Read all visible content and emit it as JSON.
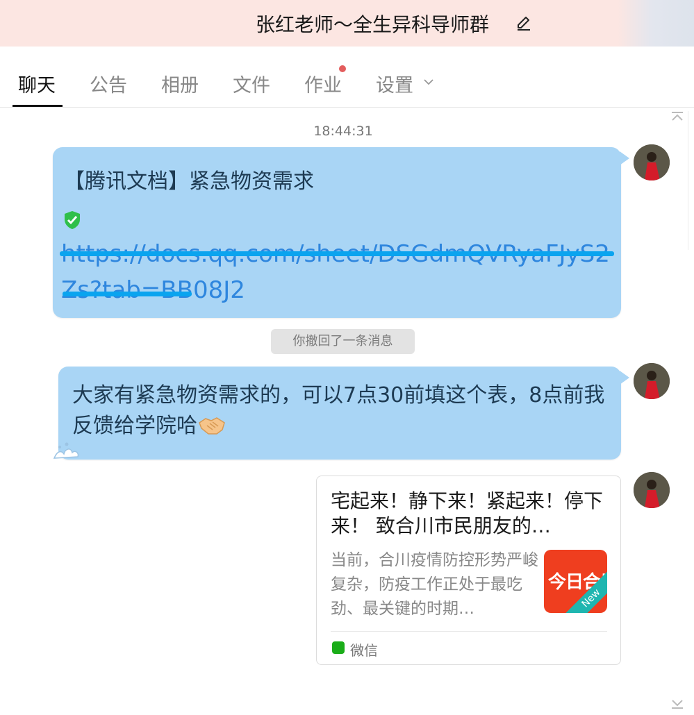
{
  "window": {
    "title": "张红老师～全生异科导师群"
  },
  "tabs": [
    {
      "label": "聊天",
      "active": true
    },
    {
      "label": "公告"
    },
    {
      "label": "相册"
    },
    {
      "label": "文件"
    },
    {
      "label": "作业",
      "badge_dot": true
    },
    {
      "label": "设置"
    }
  ],
  "chat": {
    "timestamp": "18:44:31",
    "message1": {
      "heading": "【腾讯文档】紧急物资需求",
      "link": "https://docs.qq.com/sheet/DSGdmQVRyaFJyS2Zs?tab=BB08J2",
      "icon": "shield-check-icon"
    },
    "recall_notice": "你撤回了一条消息",
    "message2": {
      "text": "大家有紧急物资需求的，可以7点30前填这个表，8点前我反馈给学院哈",
      "emoji": "handshake-icon"
    },
    "card": {
      "title": "宅起来！静下来！紧起来！停下来！  致合川市民朋友的…",
      "description": "当前，合川疫情防控形势严峻复杂，防疫工作正处于最吃劲、最关键的时期…",
      "thumb_logo": "今日合川",
      "thumb_badge": "New",
      "source": "微信"
    }
  },
  "colors": {
    "title_bar": "#fce6e2",
    "bubble": "#a9d5f5",
    "link": "#2e86de",
    "strike": "#0aa4ef",
    "wechat_green": "#1aad19",
    "thumb_red": "#ef3e1f"
  }
}
